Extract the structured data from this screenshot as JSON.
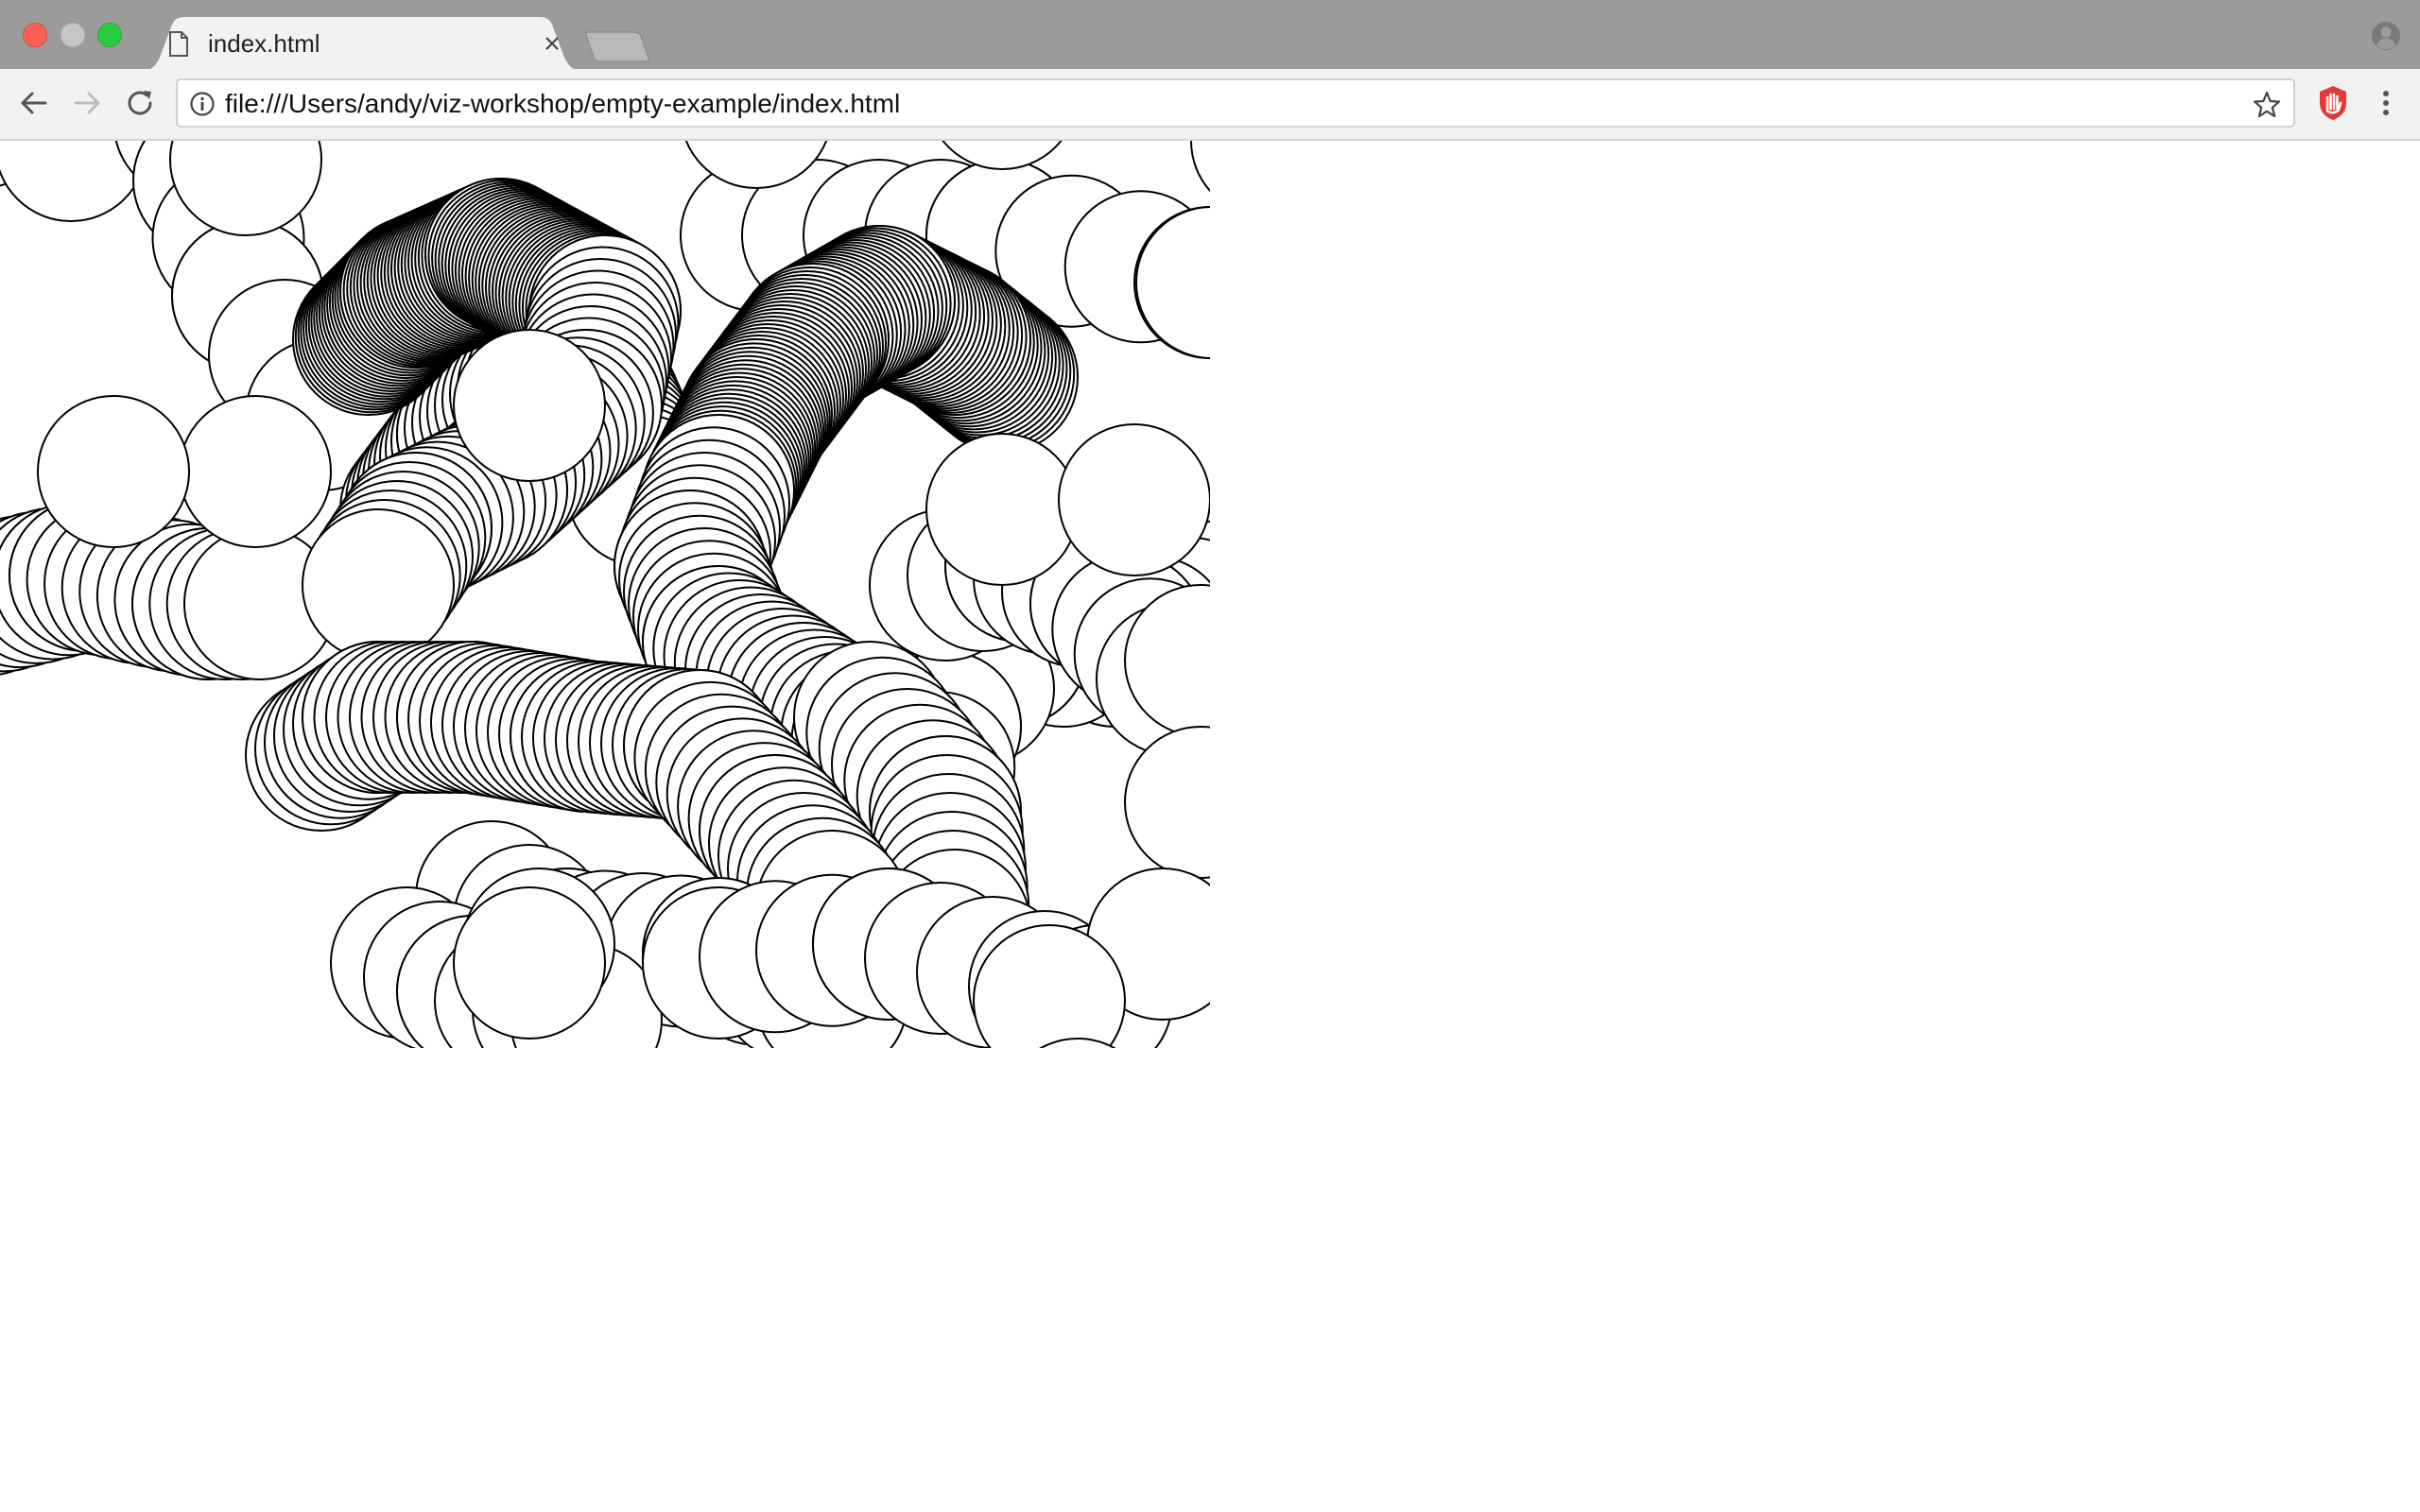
{
  "browser": {
    "tab": {
      "title": "index.html",
      "icon": "document-icon"
    },
    "address_bar": {
      "url": "file:///Users/andy/viz-workshop/empty-example/index.html",
      "info_icon": "info-icon",
      "bookmark_icon": "star-icon"
    },
    "controls": {
      "back_icon": "back-arrow-icon",
      "forward_icon": "forward-arrow-icon",
      "reload_icon": "reload-icon",
      "extension_icon": "hand-stop-icon",
      "menu_icon": "kebab-menu-icon",
      "profile_icon": "profile-icon"
    },
    "colors": {
      "titlebar": "#9b9b9b",
      "toolbar": "#f2f2f2",
      "close": "#fc5f57",
      "zoom": "#2acb42",
      "extension": "#e53935"
    }
  },
  "page": {
    "canvas_background": "#ffffff",
    "circle_stroke": "#000000",
    "circle_fill": "#ffffff"
  }
}
